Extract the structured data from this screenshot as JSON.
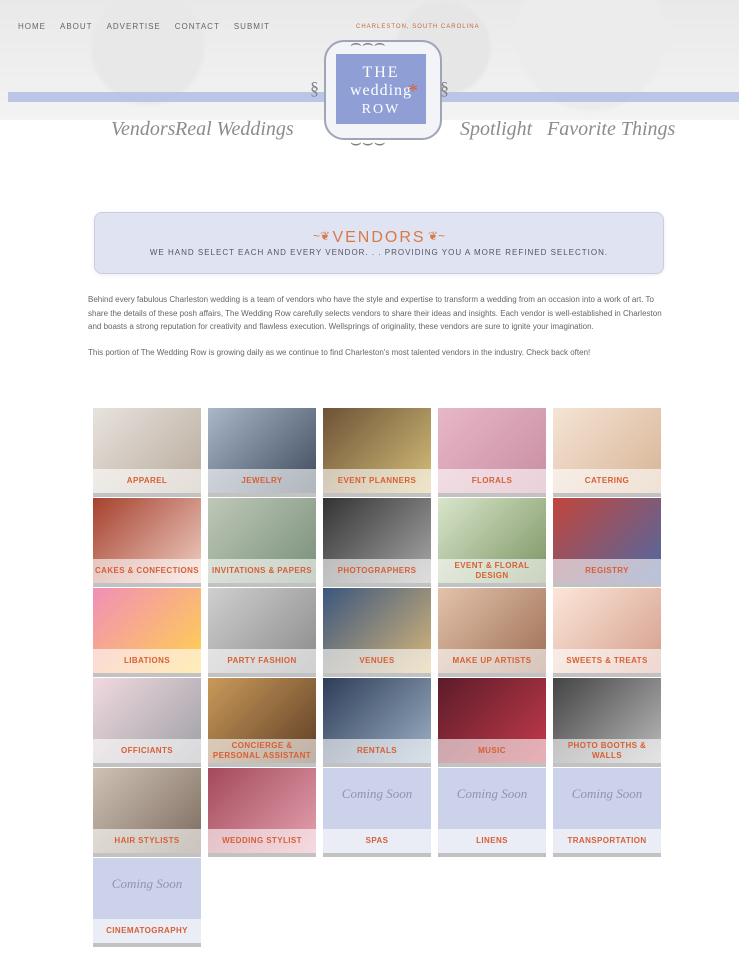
{
  "header": {
    "nav": [
      "HOME",
      "ABOUT",
      "ADVERTISE",
      "CONTACT",
      "SUBMIT"
    ],
    "logo": {
      "the": "THE",
      "wedding": "wedding",
      "row": "ROW",
      "circle": "CHARLESTON, SOUTH CAROLINA"
    },
    "script_nav": [
      "Vendors",
      "Real Weddings",
      "Spotlight",
      "Favorite Things"
    ]
  },
  "banner": {
    "title": "VENDORS",
    "tagline": "WE HAND SELECT EACH AND EVERY VENDOR. . . PROVIDING YOU A MORE REFINED SELECTION."
  },
  "intro": {
    "p1": "Behind every fabulous Charleston wedding is a team of vendors who have the style and expertise to transform a wedding from an occasion into a work of art. To share the details of these posh affairs, The Wedding Row carefully selects vendors to share their ideas and insights. Each vendor is well-established in Charleston and boasts a strong reputation for creativity and flawless execution. Wellsprings of originality, these vendors are sure to ignite your imagination.",
    "p2": "This portion of The Wedding Row is growing daily as we continue to find Charleston's most talented vendors in the industry. Check back often!"
  },
  "tiles": [
    {
      "label": "APPAREL",
      "coming": ""
    },
    {
      "label": "JEWELRY",
      "coming": ""
    },
    {
      "label": "EVENT PLANNERS",
      "coming": ""
    },
    {
      "label": "FLORALS",
      "coming": ""
    },
    {
      "label": "CATERING",
      "coming": ""
    },
    {
      "label": "CAKES & CONFECTIONS",
      "coming": ""
    },
    {
      "label": "INVITATIONS & PAPERS",
      "coming": ""
    },
    {
      "label": "PHOTOGRAPHERS",
      "coming": ""
    },
    {
      "label": "EVENT & FLORAL DESIGN",
      "coming": ""
    },
    {
      "label": "REGISTRY",
      "coming": ""
    },
    {
      "label": "LIBATIONS",
      "coming": ""
    },
    {
      "label": "PARTY FASHION",
      "coming": ""
    },
    {
      "label": "VENUES",
      "coming": ""
    },
    {
      "label": "MAKE UP ARTISTS",
      "coming": ""
    },
    {
      "label": "SWEETS & TREATS",
      "coming": ""
    },
    {
      "label": "OFFICIANTS",
      "coming": ""
    },
    {
      "label": "CONCIERGE & PERSONAL ASSISTANT",
      "coming": ""
    },
    {
      "label": "RENTALS",
      "coming": ""
    },
    {
      "label": "MUSIC",
      "coming": ""
    },
    {
      "label": "PHOTO BOOTHS & WALLS",
      "coming": ""
    },
    {
      "label": "HAIR STYLISTS",
      "coming": ""
    },
    {
      "label": "WEDDING STYLIST",
      "coming": ""
    },
    {
      "label": "SPAS",
      "coming": "Coming Soon"
    },
    {
      "label": "LINENS",
      "coming": "Coming Soon"
    },
    {
      "label": "TRANSPORTATION",
      "coming": "Coming Soon"
    },
    {
      "label": "CINEMATOGRAPHY",
      "coming": "Coming Soon"
    }
  ]
}
